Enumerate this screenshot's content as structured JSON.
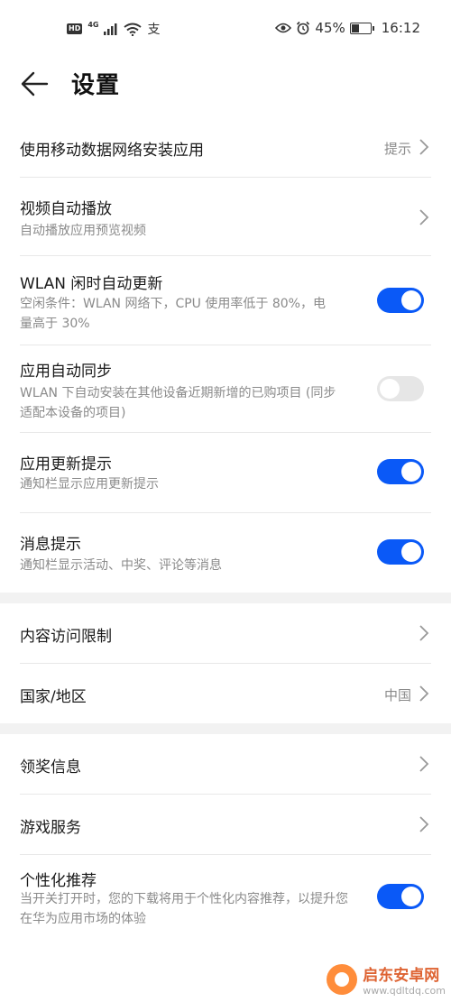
{
  "status_bar": {
    "hd": "HD",
    "network": "4G",
    "pay_icon": "支",
    "battery_percent": "45%",
    "battery_level": 0.45,
    "time": "16:12"
  },
  "header": {
    "title": "设置"
  },
  "rows": [
    {
      "title": "使用移动数据网络安装应用",
      "value": "提示",
      "control": "chevron"
    },
    {
      "title": "视频自动播放",
      "subtitle": "自动播放应用预览视频",
      "control": "chevron"
    },
    {
      "title": "WLAN 闲时自动更新",
      "subtitle": "空闲条件：WLAN 网络下，CPU 使用率低于 80%，电量高于 30%",
      "control": "toggle",
      "on": true
    },
    {
      "title": "应用自动同步",
      "subtitle": "WLAN 下自动安装在其他设备近期新增的已购项目 (同步适配本设备的项目)",
      "control": "toggle",
      "on": false
    },
    {
      "title": "应用更新提示",
      "subtitle": "通知栏显示应用更新提示",
      "control": "toggle",
      "on": true
    },
    {
      "title": "消息提示",
      "subtitle": "通知栏显示活动、中奖、评论等消息",
      "control": "toggle",
      "on": true
    },
    {
      "title": "内容访问限制",
      "control": "chevron"
    },
    {
      "title": "国家/地区",
      "value": "中国",
      "control": "chevron"
    },
    {
      "title": "领奖信息",
      "control": "chevron"
    },
    {
      "title": "游戏服务",
      "control": "chevron"
    },
    {
      "title": "个性化推荐",
      "subtitle": "当开关打开时，您的下载将用于个性化内容推荐，以提升您在华为应用市场的体验",
      "control": "toggle",
      "on": true
    }
  ],
  "watermark": {
    "name": "启东安卓网",
    "url": "www.qdltdq.com"
  },
  "colors": {
    "accent": "#0a59f7",
    "toggle_off": "#e6e6e6",
    "section_gap": "#f2f2f2"
  }
}
